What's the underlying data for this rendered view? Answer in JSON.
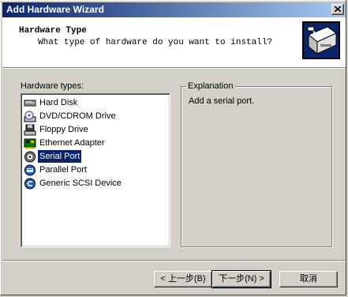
{
  "window": {
    "title": "Add Hardware Wizard"
  },
  "header": {
    "title": "Hardware Type",
    "subtitle": "What type of hardware do you want to install?"
  },
  "list": {
    "label": "Hardware types:",
    "items": [
      {
        "label": "Hard Disk",
        "icon": "hard-disk-icon"
      },
      {
        "label": "DVD/CDROM Drive",
        "icon": "cdrom-drive-icon"
      },
      {
        "label": "Floppy Drive",
        "icon": "floppy-drive-icon"
      },
      {
        "label": "Ethernet Adapter",
        "icon": "network-adapter-icon"
      },
      {
        "label": "Serial Port",
        "icon": "serial-port-icon",
        "selected": true
      },
      {
        "label": "Parallel Port",
        "icon": "parallel-port-icon"
      },
      {
        "label": "Generic SCSI Device",
        "icon": "scsi-device-icon"
      }
    ]
  },
  "explanation": {
    "label": "Explanation",
    "text": "Add a serial port."
  },
  "buttons": {
    "back": "< 上一步(B)",
    "next": "下一步(N) >",
    "cancel": "取消"
  },
  "colors": {
    "titlebar_start": "#0a246a",
    "titlebar_end": "#a6caf0",
    "selection": "#0a246a",
    "face": "#d4d0c8"
  }
}
